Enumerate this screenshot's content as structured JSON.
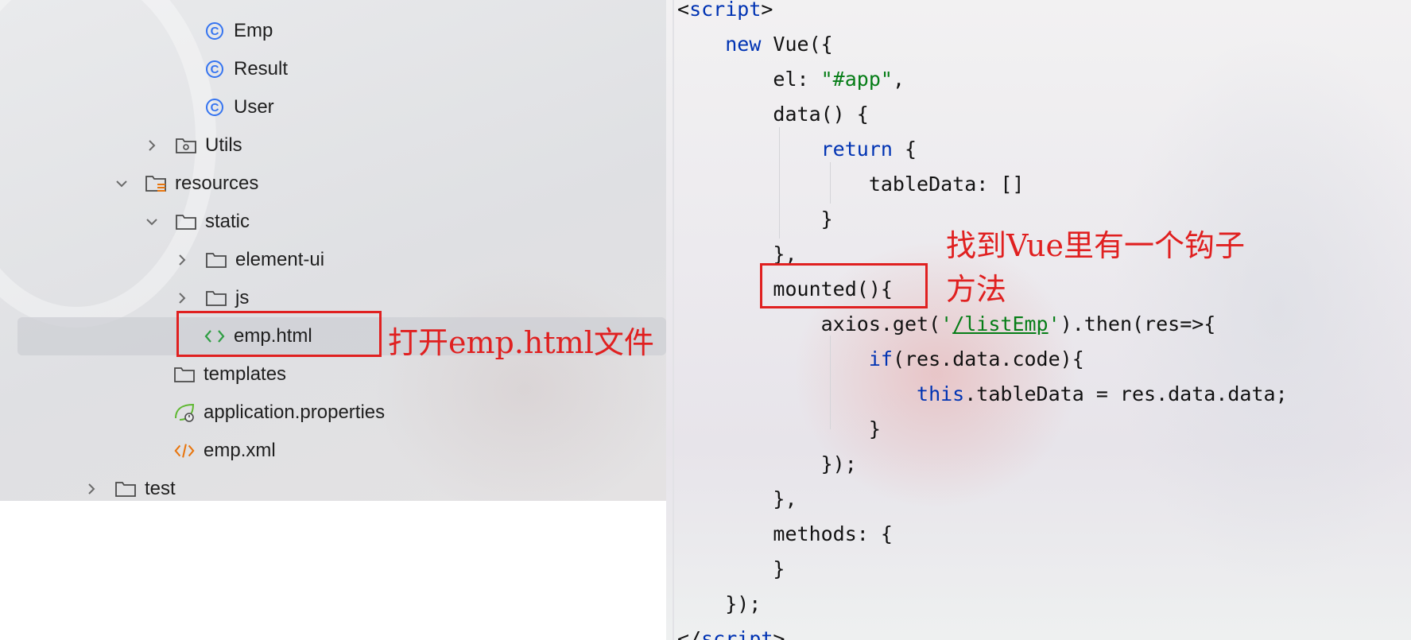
{
  "project_tree": {
    "items": [
      {
        "label": "Emp",
        "icon": "class-icon"
      },
      {
        "label": "Result",
        "icon": "class-icon"
      },
      {
        "label": "User",
        "icon": "class-icon"
      },
      {
        "label": "Utils",
        "icon": "package-folder-icon",
        "expanded": false
      },
      {
        "label": "resources",
        "icon": "resources-folder-icon",
        "expanded": true
      },
      {
        "label": "static",
        "icon": "folder-icon",
        "expanded": true
      },
      {
        "label": "element-ui",
        "icon": "folder-icon",
        "expanded": false
      },
      {
        "label": "js",
        "icon": "folder-icon",
        "expanded": false
      },
      {
        "label": "emp.html",
        "icon": "html-file-icon",
        "selected": true
      },
      {
        "label": "templates",
        "icon": "folder-icon"
      },
      {
        "label": "application.properties",
        "icon": "spring-properties-icon"
      },
      {
        "label": "emp.xml",
        "icon": "xml-file-icon"
      },
      {
        "label": "test",
        "icon": "folder-icon",
        "expanded": false
      }
    ]
  },
  "code_editor": {
    "lines": [
      {
        "tokens": [
          {
            "t": "<",
            "c": "plain"
          },
          {
            "t": "script",
            "c": "kw"
          },
          {
            "t": ">",
            "c": "plain"
          }
        ]
      },
      {
        "tokens": [
          {
            "t": "    ",
            "c": "plain"
          },
          {
            "t": "new",
            "c": "kw"
          },
          {
            "t": " Vue({",
            "c": "plain"
          }
        ]
      },
      {
        "tokens": [
          {
            "t": "        el: ",
            "c": "plain"
          },
          {
            "t": "\"#app\"",
            "c": "str"
          },
          {
            "t": ",",
            "c": "plain"
          }
        ]
      },
      {
        "tokens": [
          {
            "t": "        data() {",
            "c": "plain"
          }
        ]
      },
      {
        "tokens": [
          {
            "t": "            ",
            "c": "plain"
          },
          {
            "t": "return",
            "c": "kw"
          },
          {
            "t": " {",
            "c": "plain"
          }
        ]
      },
      {
        "tokens": [
          {
            "t": "                tableData: []",
            "c": "plain"
          }
        ]
      },
      {
        "tokens": [
          {
            "t": "            }",
            "c": "plain"
          }
        ]
      },
      {
        "tokens": [
          {
            "t": "        },",
            "c": "plain"
          }
        ]
      },
      {
        "tokens": [
          {
            "t": "        mounted(){",
            "c": "plain"
          }
        ]
      },
      {
        "tokens": [
          {
            "t": "            axios.get(",
            "c": "plain"
          },
          {
            "t": "'",
            "c": "str"
          },
          {
            "t": "/listEmp",
            "c": "url"
          },
          {
            "t": "'",
            "c": "str"
          },
          {
            "t": ").then(res=>{",
            "c": "plain"
          }
        ]
      },
      {
        "tokens": [
          {
            "t": "                ",
            "c": "plain"
          },
          {
            "t": "if",
            "c": "kw"
          },
          {
            "t": "(res.data.code){",
            "c": "plain"
          }
        ]
      },
      {
        "tokens": [
          {
            "t": "                    ",
            "c": "plain"
          },
          {
            "t": "this",
            "c": "kw"
          },
          {
            "t": ".tableData = res.data.data;",
            "c": "plain"
          }
        ]
      },
      {
        "tokens": [
          {
            "t": "                }",
            "c": "plain"
          }
        ]
      },
      {
        "tokens": [
          {
            "t": "            });",
            "c": "plain"
          }
        ]
      },
      {
        "tokens": [
          {
            "t": "        },",
            "c": "plain"
          }
        ]
      },
      {
        "tokens": [
          {
            "t": "        methods: {",
            "c": "plain"
          }
        ]
      },
      {
        "tokens": [
          {
            "t": "        }",
            "c": "plain"
          }
        ]
      },
      {
        "tokens": [
          {
            "t": "    });",
            "c": "plain"
          }
        ]
      },
      {
        "tokens": [
          {
            "t": "</",
            "c": "plain"
          },
          {
            "t": "script",
            "c": "kw"
          },
          {
            "t": ">",
            "c": "plain"
          }
        ]
      }
    ]
  },
  "annotations": {
    "open_file": "打开emp.html文件",
    "hook_line1": "找到Vue里有一个钩子",
    "hook_line2": "方法"
  },
  "colors": {
    "keyword": "#0033b3",
    "string": "#067d17",
    "annotation_red": "#e02020",
    "class_icon_blue": "#3574f0",
    "xml_icon_orange": "#e8750d",
    "spring_green": "#5fb832"
  }
}
